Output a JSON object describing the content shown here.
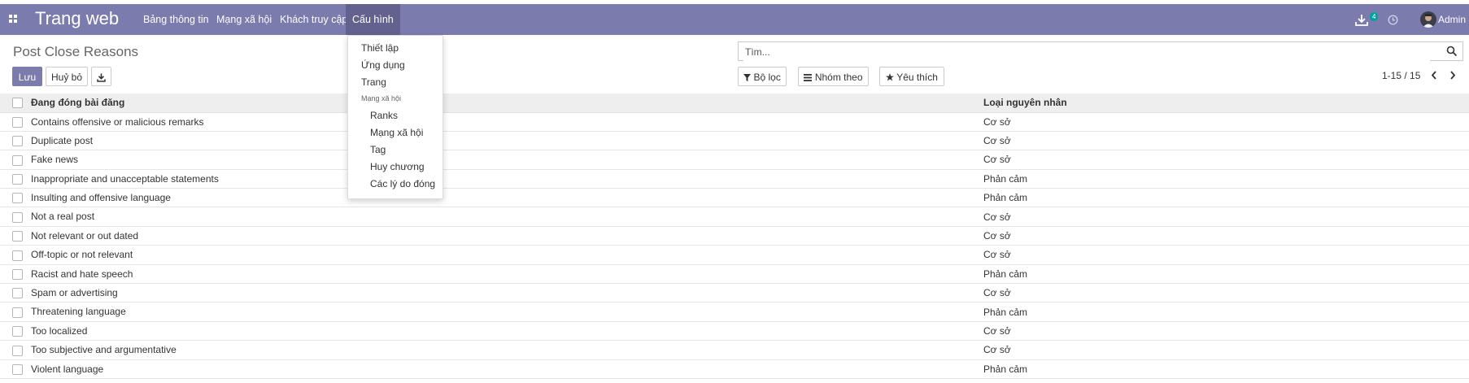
{
  "navbar": {
    "brand": "Trang web",
    "menus": [
      "Bảng thông tin",
      "Mạng xã hội",
      "Khách truy cập",
      "Cấu hình"
    ],
    "active_menu": "Cấu hình",
    "download_badge": "4",
    "user_name": "Admin",
    "accent_color": "#7c7bad"
  },
  "page": {
    "title": "Post Close Reasons",
    "save_label": "Lưu",
    "discard_label": "Huỷ bỏ",
    "search_placeholder": "Tìm...",
    "filter_label": "Bộ lọc",
    "groupby_label": "Nhóm theo",
    "favorites_label": "Yêu thích",
    "pager": "1-15 / 15"
  },
  "dropdown": {
    "items": [
      "Thiết lập",
      "Ứng dụng",
      "Trang"
    ],
    "section_header": "Mạng xã hội",
    "sub_items": [
      "Ranks",
      "Mạng xã hội",
      "Tag",
      "Huy chương",
      "Các lý do đóng"
    ]
  },
  "table": {
    "columns": [
      "Đang đóng bài đăng",
      "Loại nguyên nhân"
    ],
    "rows": [
      [
        "Contains offensive or malicious remarks",
        "Cơ sở"
      ],
      [
        "Duplicate post",
        "Cơ sở"
      ],
      [
        "Fake news",
        "Cơ sở"
      ],
      [
        "Inappropriate and unacceptable statements",
        "Phản cảm"
      ],
      [
        "Insulting and offensive language",
        "Phản cảm"
      ],
      [
        "Not a real post",
        "Cơ sở"
      ],
      [
        "Not relevant or out dated",
        "Cơ sở"
      ],
      [
        "Off-topic or not relevant",
        "Cơ sở"
      ],
      [
        "Racist and hate speech",
        "Phản cảm"
      ],
      [
        "Spam or advertising",
        "Cơ sở"
      ],
      [
        "Threatening language",
        "Phản cảm"
      ],
      [
        "Too localized",
        "Cơ sở"
      ],
      [
        "Too subjective and argumentative",
        "Cơ sở"
      ],
      [
        "Violent language",
        "Phản cảm"
      ]
    ]
  }
}
